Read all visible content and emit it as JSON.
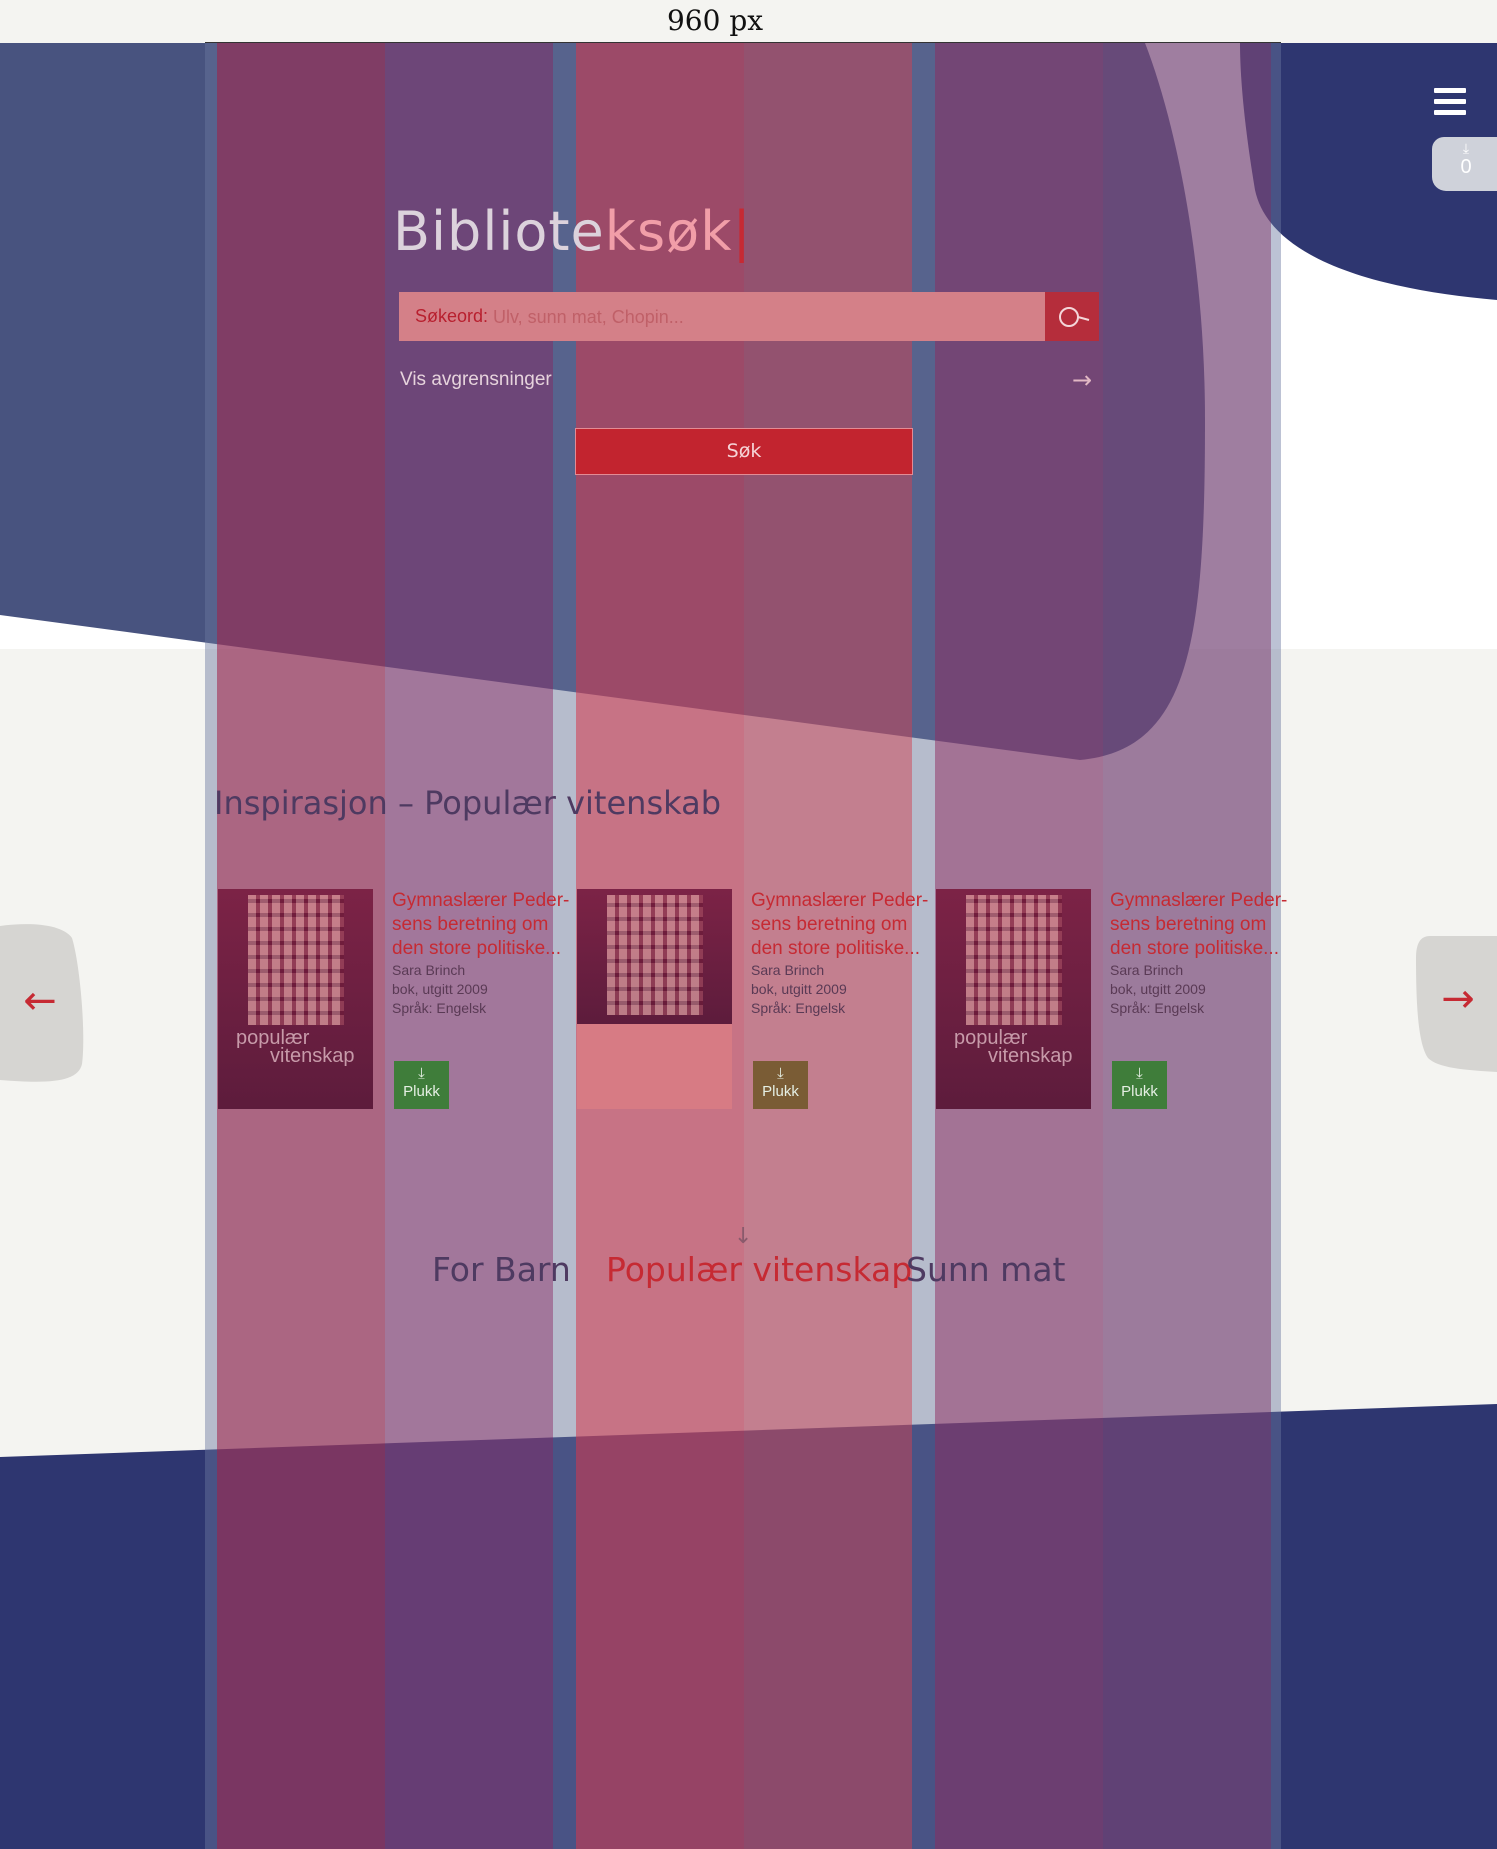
{
  "ruler": {
    "label": "960 px"
  },
  "header": {
    "menu_icon": "hamburger-icon",
    "picks": {
      "icon": "download-icon",
      "count": "0"
    }
  },
  "search": {
    "logo_part1": "Bibliote",
    "logo_part2": "ksøk",
    "logo_cursor": "|",
    "label": "Søkeord:",
    "placeholder": "Ulv, sunn mat, Chopin...",
    "button_icon": "search-icon",
    "refine_label": "Vis avgrensninger",
    "submit_label": "Søk"
  },
  "inspiration": {
    "title": "Inspirasjon – Populær vitenskab",
    "books": [
      {
        "title": "Gymnaslærer Peder-sens beretning om den store politiske...",
        "author": "Sara Brinch",
        "meta": "bok, utgitt 2009",
        "lang": "Språk: Engelsk",
        "cover_line1": "populær",
        "cover_line2": "vitenskap",
        "pick_label": "Plukk"
      },
      {
        "title": "Gymnaslærer Peder-sens beretning om den store politiske...",
        "author": "Sara Brinch",
        "meta": "bok, utgitt 2009",
        "lang": "Språk: Engelsk",
        "pick_label": "Plukk"
      },
      {
        "title": "Gymnaslærer Peder-sens beretning om den store politiske...",
        "author": "Sara Brinch",
        "meta": "bok, utgitt 2009",
        "lang": "Språk: Engelsk",
        "cover_line1": "populær",
        "cover_line2": "vitenskap",
        "pick_label": "Plukk"
      }
    ]
  },
  "categories": {
    "items": [
      {
        "label": "For Barn"
      },
      {
        "label": "Populær vitenskap",
        "active": true
      },
      {
        "label": "Sunn mat"
      }
    ]
  },
  "colors": {
    "navy": "#2e3670",
    "accent_red": "#c62a33",
    "pick_green": "#3f7d3a",
    "page_bg": "#f4f4f1"
  }
}
